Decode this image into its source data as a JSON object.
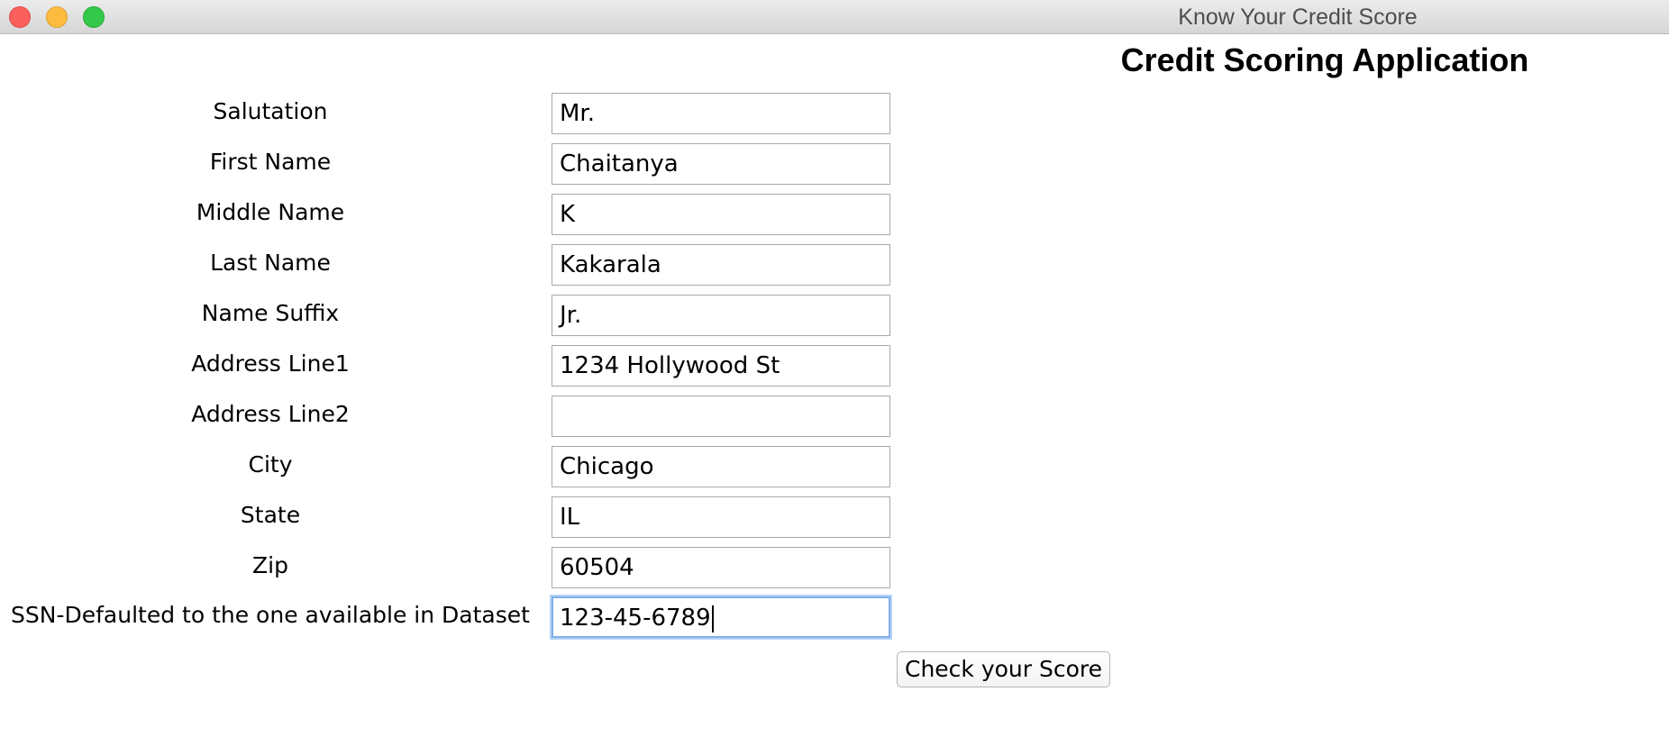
{
  "window": {
    "title": "Know Your Credit Score"
  },
  "app": {
    "heading": "Credit Scoring Application"
  },
  "form": {
    "fields": [
      {
        "label": "Salutation",
        "value": "Mr."
      },
      {
        "label": "First Name",
        "value": "Chaitanya"
      },
      {
        "label": "Middle Name",
        "value": "K"
      },
      {
        "label": "Last Name",
        "value": "Kakarala"
      },
      {
        "label": "Name Suffix",
        "value": "Jr."
      },
      {
        "label": "Address Line1",
        "value": "1234 Hollywood St"
      },
      {
        "label": "Address Line2",
        "value": ""
      },
      {
        "label": "City",
        "value": "Chicago"
      },
      {
        "label": "State",
        "value": "IL"
      },
      {
        "label": "Zip",
        "value": "60504"
      },
      {
        "label": "SSN-Defaulted to the one available in Dataset",
        "value": "123-45-6789"
      }
    ],
    "submit_label": "Check your Score"
  },
  "colors": {
    "close": "#fc605c",
    "minimize": "#fdbc40",
    "maximize": "#34c84a",
    "focus_ring": "#7fb0ea"
  }
}
